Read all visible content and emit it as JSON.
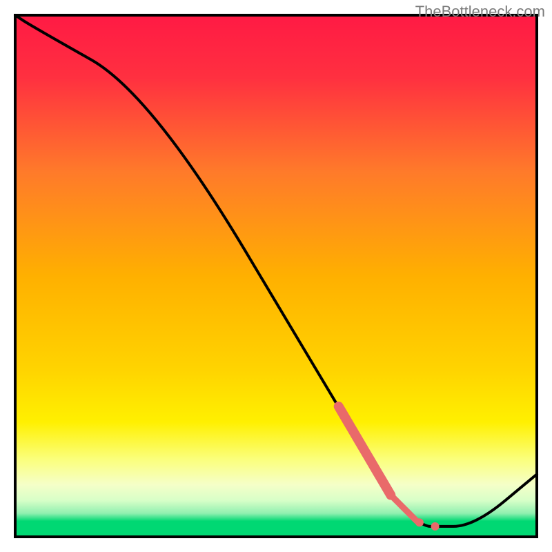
{
  "watermark": "TheBottleneck.com",
  "chart_data": {
    "type": "line",
    "title": "",
    "xlabel": "",
    "ylabel": "",
    "xlim": [
      0,
      100
    ],
    "ylim": [
      0,
      100
    ],
    "x": [
      0,
      3,
      26,
      62,
      72,
      77,
      79,
      80,
      88,
      100
    ],
    "values": [
      100,
      98,
      85,
      25,
      8,
      3,
      2,
      2,
      2,
      12
    ],
    "highlight_segments": [
      {
        "x_from": 62,
        "x_to": 72,
        "width": "thick"
      },
      {
        "x_from": 72,
        "x_to": 77,
        "width": "medium"
      }
    ],
    "highlight_points_x": [
      77.5,
      80.5
    ],
    "background_gradient": {
      "top": "#ff1a44",
      "mid": "#ffd400",
      "bottom_band": "#00d873"
    }
  }
}
